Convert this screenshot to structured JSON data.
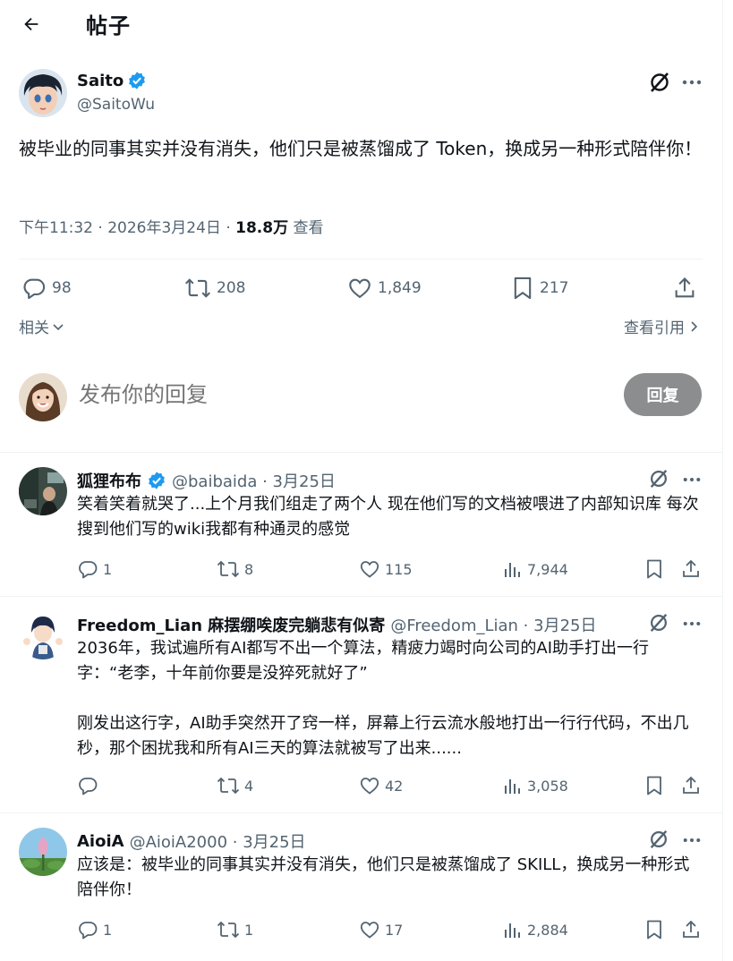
{
  "header": {
    "title": "帖子"
  },
  "post": {
    "author": "Saito",
    "handle": "@SaitoWu",
    "text": "被毕业的同事其实并没有消失，他们只是被蒸馏成了 Token，换成另一种形式陪伴你！",
    "time_date": "下午11:32 · 2026年3月24日 · ",
    "views": "18.8万",
    "views_label": " 查看",
    "stats": {
      "replies": "98",
      "reposts": "208",
      "likes": "1,849",
      "bookmarks": "217"
    },
    "related_label": "相关",
    "quotes_label": "查看引用"
  },
  "composer": {
    "placeholder": "发布你的回复",
    "button": "回复"
  },
  "replies": [
    {
      "name": "狐狸布布",
      "verified": true,
      "meta": "@baibaida · 3月25日",
      "text": "笑着笑着就哭了...上个月我们组走了两个人 现在他们写的文档被喂进了内部知识库 每次搜到他们写的wiki我都有种通灵的感觉",
      "replies": "1",
      "reposts": "8",
      "likes": "115",
      "views": "7,944"
    },
    {
      "name": "Freedom_Lian 麻摆绷唉废完躺悲有似寄",
      "verified": false,
      "meta": "@Freedom_Lian · 3月25日",
      "text": "2036年，我试遍所有AI都写不出一个算法，精疲力竭时向公司的AI助手打出一行字：“老李，十年前你要是没猝死就好了”\n\n刚发出这行字，AI助手突然开了窍一样，屏幕上行云流水般地打出一行行代码，不出几秒，那个困扰我和所有AI三天的算法就被写了出来......",
      "replies": "",
      "reposts": "4",
      "likes": "42",
      "views": "3,058"
    },
    {
      "name": "AioiA",
      "verified": false,
      "meta": "@AioiA2000 · 3月25日",
      "text": "应该是：被毕业的同事其实并没有消失，他们只是被蒸馏成了 SKILL，换成另一种形式陪伴你！",
      "replies": "1",
      "reposts": "1",
      "likes": "17",
      "views": "2,884"
    }
  ],
  "colors": {
    "accent": "#1d9bf0",
    "muted": "#536471",
    "text": "#0f1419",
    "button": "#8b8d8f"
  },
  "icons": [
    "back-arrow-icon",
    "verified-badge-icon",
    "grok-icon",
    "more-icon",
    "reply-icon",
    "repost-icon",
    "like-icon",
    "bookmark-icon",
    "share-icon",
    "views-icon",
    "chevron-down-icon",
    "chevron-right-icon"
  ]
}
